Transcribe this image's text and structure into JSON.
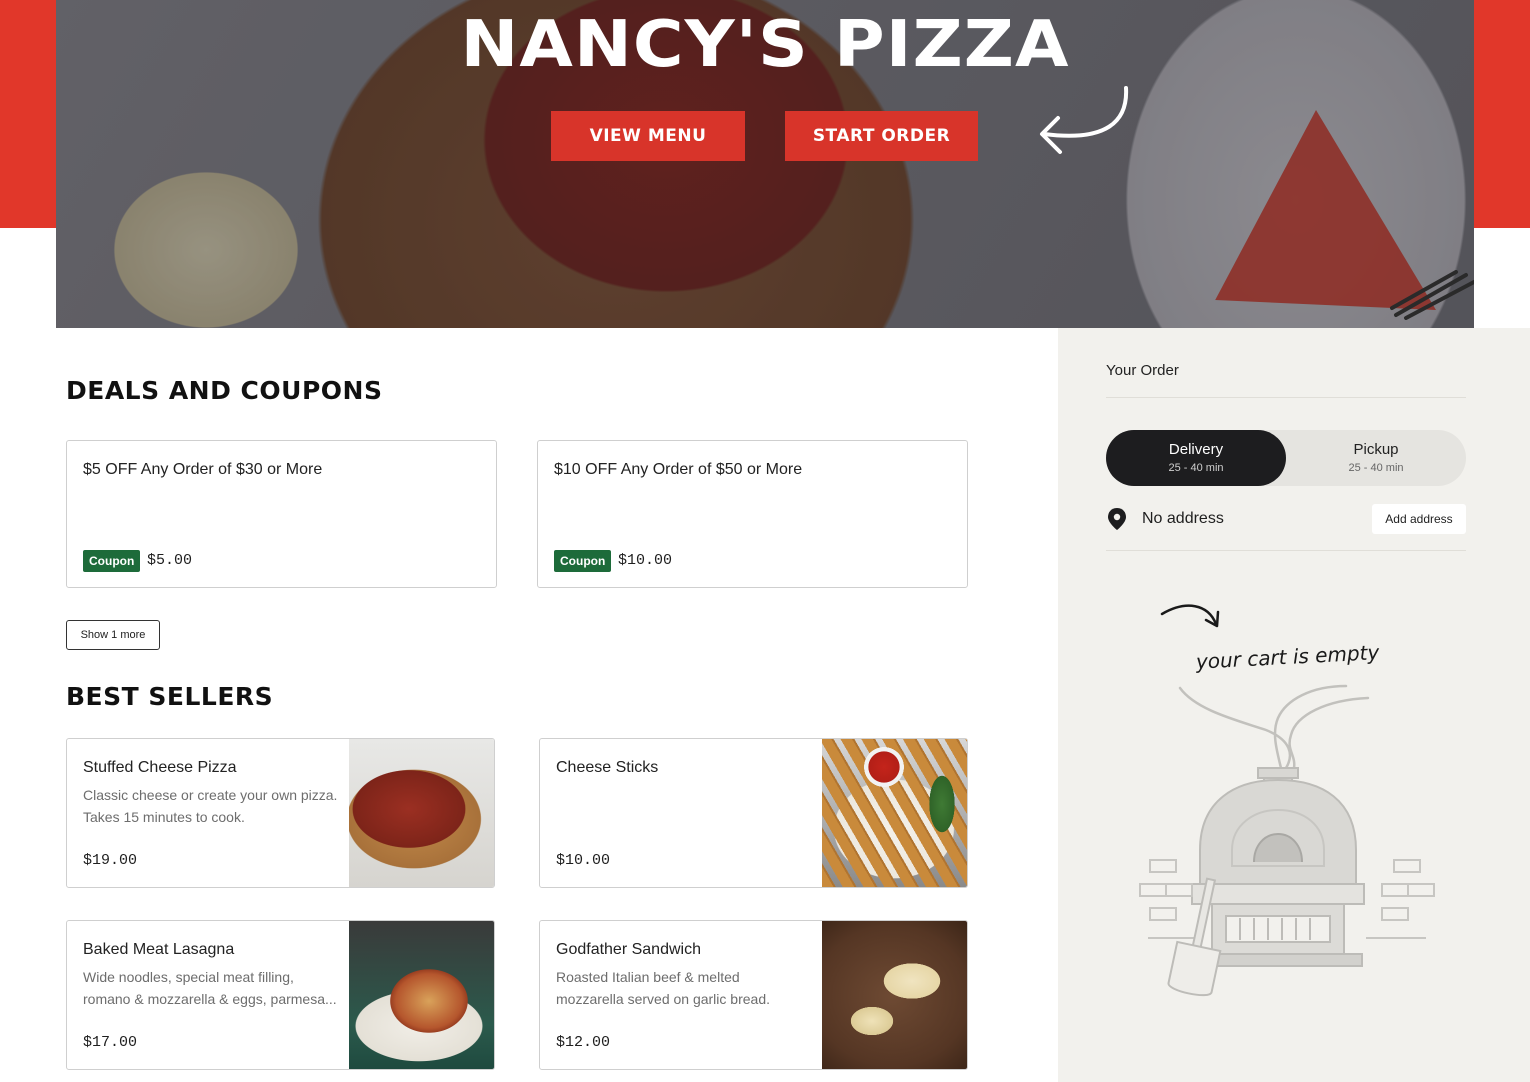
{
  "hero": {
    "title": "NANCY'S PIZZA",
    "view_menu_label": "VIEW MENU",
    "start_order_label": "START ORDER"
  },
  "deals": {
    "title": "DEALS AND COUPONS",
    "coupons": [
      {
        "title": "$5 OFF Any Order of $30 or More",
        "badge": "Coupon",
        "price": "$5.00"
      },
      {
        "title": "$10 OFF Any Order of $50 or More",
        "badge": "Coupon",
        "price": "$10.00"
      }
    ],
    "show_more_label": "Show 1 more"
  },
  "best_sellers": {
    "title": "BEST SELLERS",
    "items": [
      {
        "name": "Stuffed Cheese Pizza",
        "description": "Classic cheese or create your own pizza. Takes 15 minutes to cook.",
        "price": "$19.00"
      },
      {
        "name": "Cheese Sticks",
        "description": "",
        "price": "$10.00"
      },
      {
        "name": "Baked Meat Lasagna",
        "description": "Wide noodles, special meat filling, romano & mozzarella & eggs, parmesa...",
        "price": "$17.00"
      },
      {
        "name": "Godfather Sandwich",
        "description": "Roasted Italian beef & melted mozzarella served on garlic bread.",
        "price": "$12.00"
      }
    ]
  },
  "order": {
    "title": "Your Order",
    "delivery": {
      "label": "Delivery",
      "time": "25 - 40 min"
    },
    "pickup": {
      "label": "Pickup",
      "time": "25 - 40 min"
    },
    "address_text": "No address",
    "add_address_label": "Add address",
    "empty_cart_text": "your cart is empty"
  },
  "colors": {
    "brand_red": "#e1372a",
    "coupon_green": "#1d6b3a",
    "sidebar_bg": "#f2f1ed",
    "toggle_active": "#1d1d1f"
  }
}
